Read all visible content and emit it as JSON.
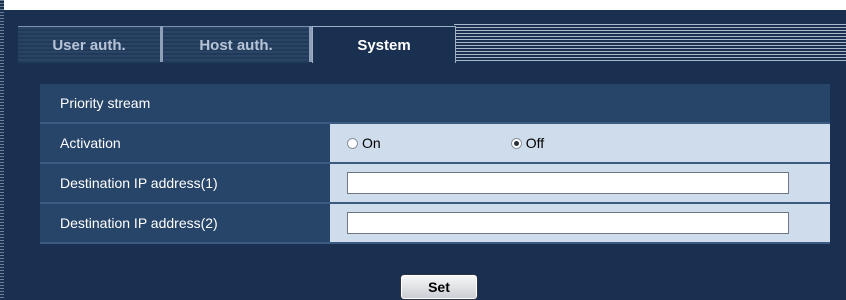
{
  "tabs": [
    {
      "label": "User auth.",
      "active": false
    },
    {
      "label": "Host auth.",
      "active": false
    },
    {
      "label": "System",
      "active": true
    }
  ],
  "section": {
    "title": "Priority stream"
  },
  "rows": {
    "activation": {
      "label": "Activation",
      "options": [
        {
          "label": "On",
          "checked": false
        },
        {
          "label": "Off",
          "checked": true
        }
      ]
    },
    "dest1": {
      "label": "Destination IP address(1)",
      "value": ""
    },
    "dest2": {
      "label": "Destination IP address(2)",
      "value": ""
    }
  },
  "actions": {
    "set_label": "Set"
  },
  "colors": {
    "background": "#1a3050",
    "row_label": "#274469",
    "row_value": "#cfdcec"
  }
}
